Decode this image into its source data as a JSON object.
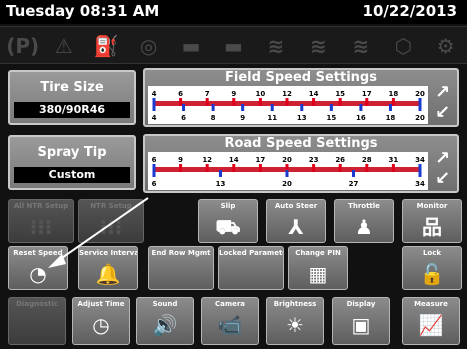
{
  "header": {
    "day_time": "Tuesday 08:31 AM",
    "date": "10/22/2013"
  },
  "warnings": [
    {
      "icon": "park-icon",
      "glyph": "(P)"
    },
    {
      "icon": "warning-icon",
      "glyph": "⚠"
    },
    {
      "icon": "fuel-filter-icon",
      "glyph": "⛽"
    },
    {
      "icon": "oil-can-icon",
      "glyph": "◎"
    },
    {
      "icon": "battery-icon",
      "glyph": "▬"
    },
    {
      "icon": "engine-icon",
      "glyph": "▬"
    },
    {
      "icon": "radiator-icon",
      "glyph": "≋"
    },
    {
      "icon": "transmission-icon",
      "glyph": "≋"
    },
    {
      "icon": "hydraulic-icon",
      "glyph": "≋"
    },
    {
      "icon": "engine-warning-icon",
      "glyph": "⬡"
    },
    {
      "icon": "gear-icon",
      "glyph": "⚙"
    }
  ],
  "tire": {
    "label": "Tire Size",
    "value": "380/90R46"
  },
  "spray": {
    "label": "Spray Tip",
    "value": "Custom"
  },
  "field_speed": {
    "title": "Field Speed Settings",
    "top_ticks": [
      "4",
      "6",
      "7",
      "9",
      "10",
      "12",
      "14",
      "15",
      "17",
      "18",
      "20"
    ],
    "bottom_ticks": [
      "4",
      "6",
      "8",
      "9",
      "11",
      "13",
      "15",
      "16",
      "18",
      "20"
    ]
  },
  "road_speed": {
    "title": "Road Speed Settings",
    "top_ticks": [
      "6",
      "9",
      "12",
      "14",
      "17",
      "20",
      "23",
      "26",
      "28",
      "31",
      "34"
    ],
    "bottom_ticks": [
      "6",
      "13",
      "20",
      "27",
      "34"
    ]
  },
  "buttons_row1": [
    {
      "label": "All NTR Setup",
      "icon": "nozzle-icon",
      "glyph": "⁝⁝⁝",
      "dim": true
    },
    {
      "label": "NTR Setup",
      "icon": "nozzle-icon",
      "glyph": "⁝⁝⁝",
      "dim": true
    },
    {
      "label": "Slip",
      "icon": "tractor-icon",
      "glyph": "⛟",
      "dim": false
    },
    {
      "label": "Auto Steer",
      "icon": "steer-icon",
      "glyph": "⅄",
      "dim": false
    },
    {
      "label": "Throttle",
      "icon": "throttle-icon",
      "glyph": "♟",
      "dim": false
    },
    {
      "label": "Monitor",
      "icon": "network-icon",
      "glyph": "品",
      "dim": false
    }
  ],
  "buttons_row2": [
    {
      "label": "Reset Speed",
      "icon": "stopwatch-icon",
      "glyph": "◔",
      "dim": false
    },
    {
      "label": "Service Intervals",
      "icon": "bell-icon",
      "glyph": "🔔",
      "dim": false
    },
    {
      "label": "End Row Mgmt",
      "icon": "end-row-icon",
      "glyph": "",
      "dim": false
    },
    {
      "label": "Locked Parameters",
      "icon": "lock-params-icon",
      "glyph": "",
      "dim": false
    },
    {
      "label": "Change PIN",
      "icon": "keypad-icon",
      "glyph": "▦",
      "dim": false
    },
    {
      "label": "Lock",
      "icon": "padlock-icon",
      "glyph": "🔓",
      "dim": false
    }
  ],
  "buttons_row3": [
    {
      "label": "Diagnostic",
      "icon": "diagnostic-icon",
      "glyph": "",
      "dim": true
    },
    {
      "label": "Adjust Time",
      "icon": "clock-icon",
      "glyph": "◷",
      "dim": false
    },
    {
      "label": "Sound",
      "icon": "speaker-icon",
      "glyph": "🔊",
      "dim": false
    },
    {
      "label": "Camera",
      "icon": "camera-icon",
      "glyph": "📹",
      "dim": false
    },
    {
      "label": "Brightness",
      "icon": "sun-icon",
      "glyph": "☀",
      "dim": false
    },
    {
      "label": "Display",
      "icon": "display-icon",
      "glyph": "▣",
      "dim": false
    },
    {
      "label": "Measure",
      "icon": "graph-icon",
      "glyph": "📈",
      "dim": false
    }
  ],
  "colors": {
    "red": "#e0001b",
    "blue": "#1a3ad0",
    "yellow": "#ffd800"
  }
}
